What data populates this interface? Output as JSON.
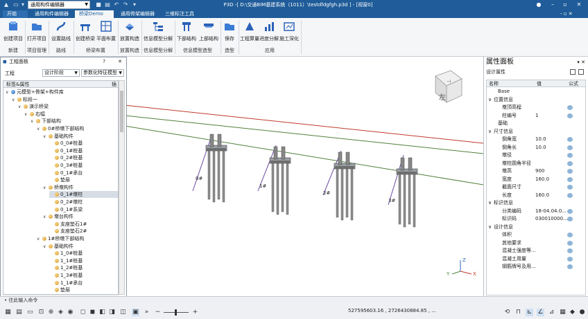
{
  "titlebar": {
    "combo_value": "通用构件编辑器",
    "title": "P3D -[ D:\\交通BIM基建系统（1011）\\testdfdgfgh.p3d ] - [视窗0]"
  },
  "tabs": [
    {
      "label": "开始"
    },
    {
      "label": "通用构件编辑器"
    },
    {
      "label": "桥梁Demo"
    },
    {
      "label": "通用骨架编辑器"
    },
    {
      "label": "三维标注工具"
    }
  ],
  "ribbon": {
    "buttons": [
      {
        "label": "创建项目"
      },
      {
        "label": "打开项目"
      },
      {
        "label": "设置路线"
      },
      {
        "label": "创建桥梁"
      },
      {
        "label": "平面布置"
      },
      {
        "label": "放置构造"
      },
      {
        "label": "信息模型分解"
      },
      {
        "label": "下部结构"
      },
      {
        "label": "上部结构"
      },
      {
        "label": "保存"
      },
      {
        "label": "工程算量"
      },
      {
        "label": "进度分解"
      },
      {
        "label": "施工深化"
      }
    ],
    "groups": [
      {
        "label": "新建"
      },
      {
        "label": "项目管理"
      },
      {
        "label": "路线"
      },
      {
        "label": "桥梁布置"
      },
      {
        "label": "放置构造"
      },
      {
        "label": "信息模型分解"
      },
      {
        "label": "信息模型造型"
      },
      {
        "label": "造型"
      },
      {
        "label": "应用"
      }
    ]
  },
  "project_panel": {
    "title": "工程面板",
    "help": "?",
    "close": "✕",
    "row_label": "工程",
    "stage_value": "设计阶段",
    "model_value": "参数化特征模型",
    "col_name": "标签&属性",
    "col_extra": "插",
    "tree": [
      {
        "text": "元模型+骨架+构件库",
        "level": 0,
        "toggle": "∨",
        "icon": "moon"
      },
      {
        "text": "标段一",
        "level": 1,
        "toggle": "∨",
        "icon": "ball"
      },
      {
        "text": "演示桥梁",
        "level": 2,
        "toggle": "∨",
        "icon": "ball"
      },
      {
        "text": "右幅",
        "level": 3,
        "toggle": "∨",
        "icon": "ball"
      },
      {
        "text": "下部结构",
        "level": 4,
        "toggle": "∨",
        "icon": "ball"
      },
      {
        "text": "0#桥墩下部结构",
        "level": 5,
        "toggle": "∨",
        "icon": "ball"
      },
      {
        "text": "基础构件",
        "level": 6,
        "toggle": "∨",
        "icon": "ball"
      },
      {
        "text": "0_0#桩基",
        "level": 7,
        "toggle": "",
        "icon": "ball"
      },
      {
        "text": "0_1#桩基",
        "level": 7,
        "toggle": "",
        "icon": "ball"
      },
      {
        "text": "0_2#桩基",
        "level": 7,
        "toggle": "",
        "icon": "ball"
      },
      {
        "text": "0_3#桩基",
        "level": 7,
        "toggle": "",
        "icon": "ball"
      },
      {
        "text": "0_1#承台",
        "level": 7,
        "toggle": "",
        "icon": "ball"
      },
      {
        "text": "垫层",
        "level": 7,
        "toggle": "",
        "icon": "ball"
      },
      {
        "text": "桥墩构件",
        "level": 6,
        "toggle": "∨",
        "icon": "ball"
      },
      {
        "text": "0_1#墩柱",
        "level": 7,
        "toggle": "",
        "icon": "ball",
        "selected": true
      },
      {
        "text": "0_2#墩柱",
        "level": 7,
        "toggle": "",
        "icon": "ball"
      },
      {
        "text": "0_1#系梁",
        "level": 7,
        "toggle": "",
        "icon": "ball"
      },
      {
        "text": "墩台构件",
        "level": 6,
        "toggle": "∨",
        "icon": "ball"
      },
      {
        "text": "支座垫石1#",
        "level": 7,
        "toggle": "",
        "icon": "ball"
      },
      {
        "text": "支座垫石2#",
        "level": 7,
        "toggle": "",
        "icon": "ball"
      },
      {
        "text": "1#桥墩下部结构",
        "level": 5,
        "toggle": "∨",
        "icon": "ball"
      },
      {
        "text": "基础构件",
        "level": 6,
        "toggle": "∨",
        "icon": "ball"
      },
      {
        "text": "1_0#桩基",
        "level": 7,
        "toggle": "",
        "icon": "ball"
      },
      {
        "text": "1_1#桩基",
        "level": 7,
        "toggle": "",
        "icon": "ball"
      },
      {
        "text": "1_2#桩基",
        "level": 7,
        "toggle": "",
        "icon": "ball"
      },
      {
        "text": "1_3#桩基",
        "level": 7,
        "toggle": "",
        "icon": "ball"
      },
      {
        "text": "1_1#承台",
        "level": 7,
        "toggle": "",
        "icon": "ball"
      },
      {
        "text": "垫层",
        "level": 7,
        "toggle": "",
        "icon": "ball"
      }
    ]
  },
  "viewport": {
    "pier_labels": [
      "0#",
      "1#",
      "2#",
      "3#"
    ],
    "view_cube_label": "左",
    "axis_labels": {
      "x": "X",
      "y": "Y",
      "z": "Z"
    },
    "line_colors": {
      "red": "#c0392b",
      "green": "#4f7f3a",
      "purple": "#6a4aa0"
    }
  },
  "properties_panel": {
    "title": "属性面板",
    "subtitle": "设计属性",
    "col_name": "名称",
    "col_value": "值",
    "col_formula": "公式",
    "rows": [
      {
        "name": "Base",
        "value": "",
        "indent": 1,
        "toggle": "",
        "dot": false
      },
      {
        "name": "位置信息",
        "value": "",
        "indent": 0,
        "toggle": "∨",
        "dot": false
      },
      {
        "name": "墩顶高程",
        "value": "",
        "indent": 2,
        "toggle": "",
        "dot": true
      },
      {
        "name": "柱编号",
        "value": "1",
        "indent": 2,
        "toggle": "",
        "dot": true
      },
      {
        "name": "基础",
        "value": "",
        "indent": 1,
        "toggle": "",
        "dot": false
      },
      {
        "name": "尺寸信息",
        "value": "",
        "indent": 0,
        "toggle": "∨",
        "dot": false
      },
      {
        "name": "倒角宽",
        "value": "10.0",
        "indent": 2,
        "toggle": "",
        "dot": true
      },
      {
        "name": "倒角长",
        "value": "10.0",
        "indent": 2,
        "toggle": "",
        "dot": true
      },
      {
        "name": "墩径",
        "value": "",
        "indent": 2,
        "toggle": "",
        "dot": true
      },
      {
        "name": "墩柱圆角半径",
        "value": "",
        "indent": 2,
        "toggle": "",
        "dot": true
      },
      {
        "name": "墩高",
        "value": "900",
        "indent": 2,
        "toggle": "",
        "dot": true
      },
      {
        "name": "宽度",
        "value": "160.0",
        "indent": 2,
        "toggle": "",
        "dot": true
      },
      {
        "name": "截面尺寸",
        "value": "",
        "indent": 2,
        "toggle": "",
        "dot": true
      },
      {
        "name": "长度",
        "value": "160.0",
        "indent": 2,
        "toggle": "",
        "dot": true
      },
      {
        "name": "标识信息",
        "value": "",
        "indent": 0,
        "toggle": "∨",
        "dot": false
      },
      {
        "name": "分类编码",
        "value": "18-04.04.0...",
        "indent": 2,
        "toggle": "",
        "dot": true
      },
      {
        "name": "标识码",
        "value": "030010000...",
        "indent": 2,
        "toggle": "",
        "dot": true
      },
      {
        "name": "设计信息",
        "value": "",
        "indent": 0,
        "toggle": "∨",
        "dot": false
      },
      {
        "name": "体积",
        "value": "",
        "indent": 2,
        "toggle": "",
        "dot": true
      },
      {
        "name": "其他要求",
        "value": "",
        "indent": 2,
        "toggle": "",
        "dot": true
      },
      {
        "name": "混凝土强度等...",
        "value": "",
        "indent": 2,
        "toggle": "",
        "dot": true
      },
      {
        "name": "混凝土用量",
        "value": "",
        "indent": 2,
        "toggle": "",
        "dot": true
      },
      {
        "name": "钢筋牌号及用...",
        "value": "",
        "indent": 2,
        "toggle": "",
        "dot": true
      }
    ]
  },
  "statusbar": {
    "command_prompt": "• 往此输入命令",
    "coordinates": "527595603.16 , 2726430884.85 , ..."
  }
}
